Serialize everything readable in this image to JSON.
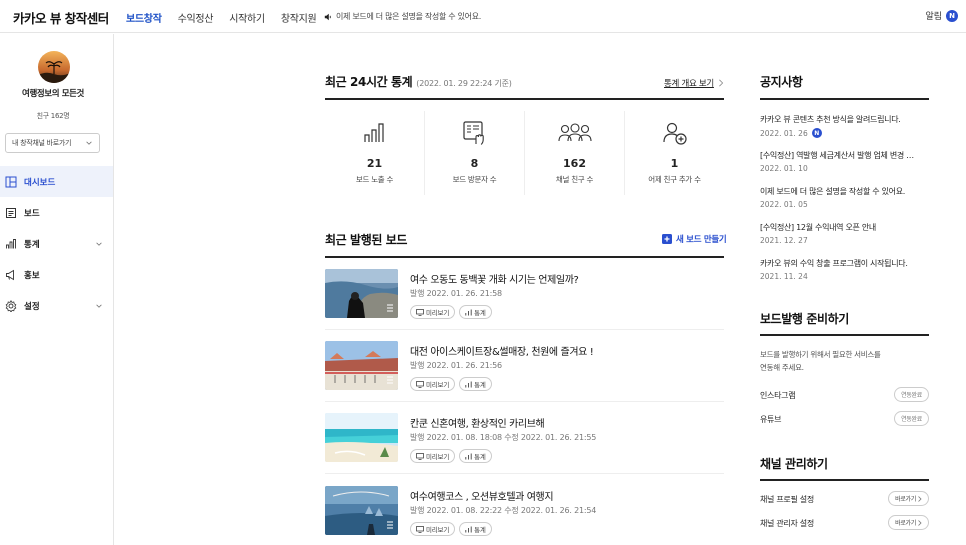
{
  "header": {
    "brand": "카카오 뷰 창작센터",
    "nav": [
      "보드창작",
      "수익정산",
      "시작하기",
      "창작지원"
    ],
    "notice": "이제 보드에 더 많은 설명을 작성할 수 있어요.",
    "alarm_label": "알림",
    "alarm_badge": "N"
  },
  "sidebar": {
    "channel_name": "여행정보의 모든것",
    "friends": "친구 162명",
    "channel_select": "내 창작채널 바로가기",
    "menu": [
      {
        "label": "대시보드",
        "icon": "dashboard-icon",
        "active": true
      },
      {
        "label": "보드",
        "icon": "board-icon"
      },
      {
        "label": "통계",
        "icon": "stats-icon",
        "expandable": true
      },
      {
        "label": "홍보",
        "icon": "megaphone-icon"
      },
      {
        "label": "설정",
        "icon": "gear-icon",
        "expandable": true
      }
    ]
  },
  "stats": {
    "title": "최근 24시간 통계",
    "subtitle": "(2022. 01. 29 22:24 기준)",
    "overview_link": "통계 개요 보기",
    "items": [
      {
        "value": "21",
        "label": "보드 노출 수"
      },
      {
        "value": "8",
        "label": "보드 방문자 수"
      },
      {
        "value": "162",
        "label": "채널 친구 수"
      },
      {
        "value": "1",
        "label": "어제 친구 추가 수"
      }
    ]
  },
  "recent_boards": {
    "title": "최근 발행된 보드",
    "new_board": "새 보드 만들기",
    "preview_label": "미리보기",
    "stats_label": "통계",
    "posts": [
      {
        "title": "여수 오동도 동백꽃 개화 시기는 언제일까?",
        "date": "발행 2022. 01. 26. 21:58"
      },
      {
        "title": "대전 아이스케이트장&썰매장, 천원에 즐겨요 !",
        "date": "발행 2022. 01. 26. 21:56"
      },
      {
        "title": "칸쿤 신혼여행, 환상적인 카리브해",
        "date": "발행 2022. 01. 08. 18:08   수정 2022. 01. 26. 21:55"
      },
      {
        "title": "여수여행코스 , 오션뷰호텔과 여행지",
        "date": "발행 2022. 01. 08. 22:22   수정 2022. 01. 26. 21:54"
      }
    ]
  },
  "notices": {
    "title": "공지사항",
    "items": [
      {
        "title": "카카오 뷰 콘텐츠 추천 방식을 알려드립니다.",
        "date": "2022. 01. 26",
        "new": "N"
      },
      {
        "title": "[수익정산] 역발행 세금계산서 발행 업체 변경 …",
        "date": "2022. 01. 10"
      },
      {
        "title": "이제 보드에 더 많은 설명을 작성할 수 있어요.",
        "date": "2022. 01. 05"
      },
      {
        "title": "[수익정산] 12월 수익내역 오픈 안내",
        "date": "2021. 12. 27"
      },
      {
        "title": "카카오 뷰의 수익 창출 프로그램이 시작됩니다.",
        "date": "2021. 11. 24"
      }
    ]
  },
  "prep": {
    "title": "보드발행 준비하기",
    "desc_line1": "보드를 발행하기 위해서 필요한 서비스를",
    "desc_line2": "연동해 주세요.",
    "items": [
      {
        "label": "인스타그램",
        "status": "연동완료"
      },
      {
        "label": "유튜브",
        "status": "연동완료"
      }
    ]
  },
  "channel_manage": {
    "title": "채널 관리하기",
    "items": [
      {
        "label": "채널 프로필 설정",
        "action": "바로가기"
      },
      {
        "label": "채널 관리자 설정",
        "action": "바로가기"
      }
    ]
  },
  "colors": {
    "accent": "#2a4fcf",
    "text": "#222222",
    "muted": "#777777"
  }
}
